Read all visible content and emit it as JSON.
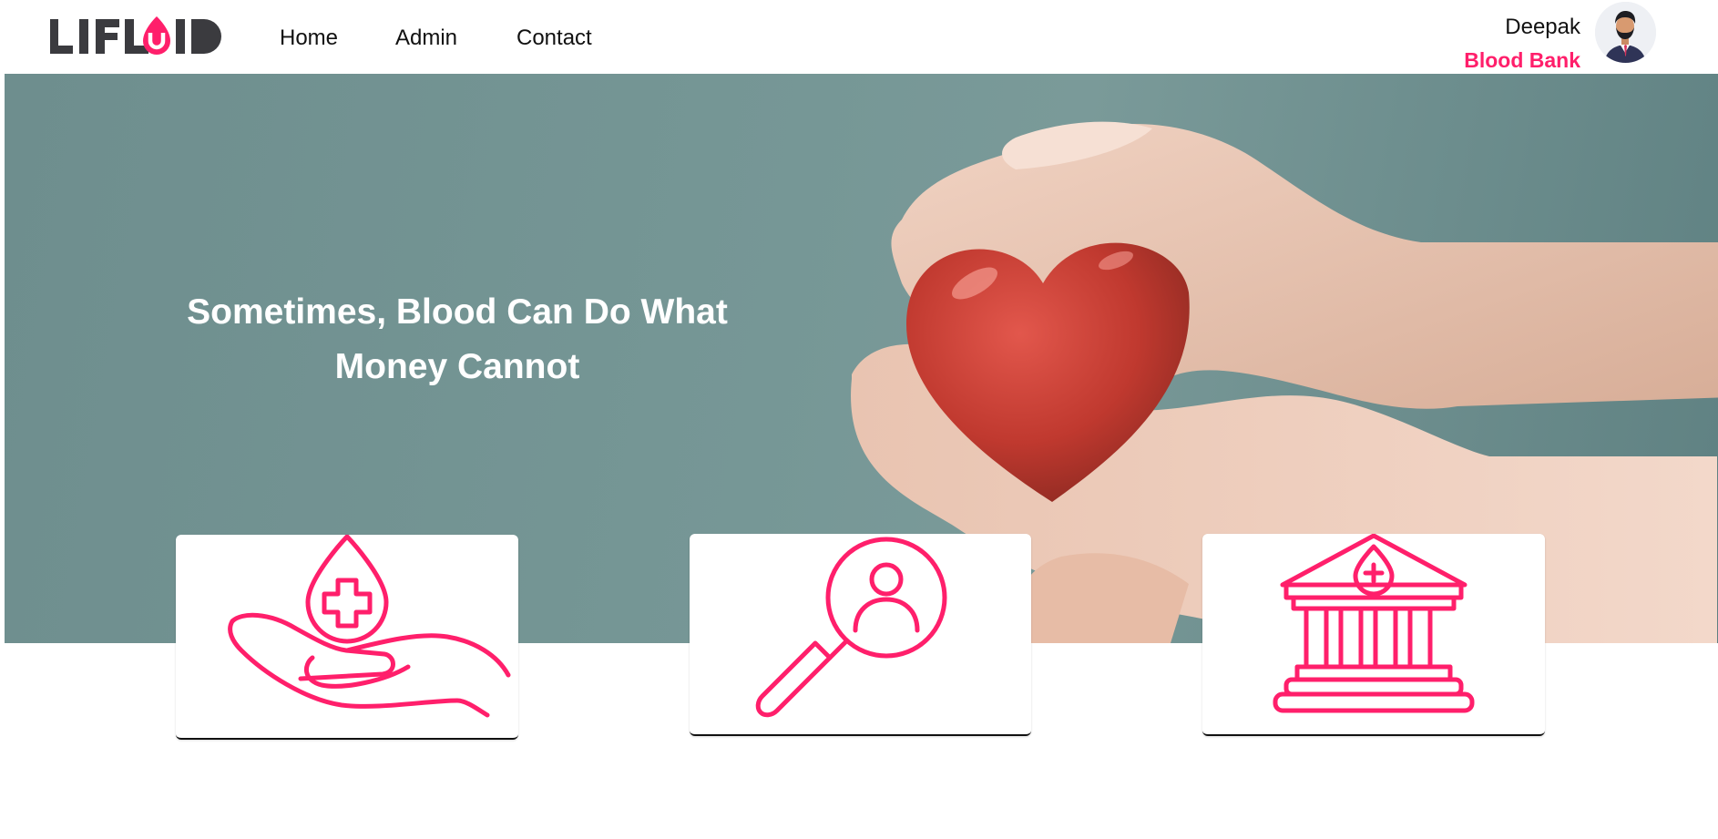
{
  "header": {
    "logo_text": "LIFLUID",
    "nav": [
      {
        "label": "Home"
      },
      {
        "label": "Admin"
      },
      {
        "label": "Contact"
      }
    ],
    "user": {
      "name": "Deepak",
      "role": "Blood Bank"
    }
  },
  "hero": {
    "title": "Sometimes, Blood Can Do What Money Cannot"
  },
  "cards": [
    {
      "icon": "donate-blood-hand-icon"
    },
    {
      "icon": "search-donor-icon"
    },
    {
      "icon": "blood-bank-building-icon"
    }
  ],
  "colors": {
    "accent": "#ff1f6b",
    "logo_dark": "#3b3b3f",
    "hero_bg": "#769796"
  }
}
